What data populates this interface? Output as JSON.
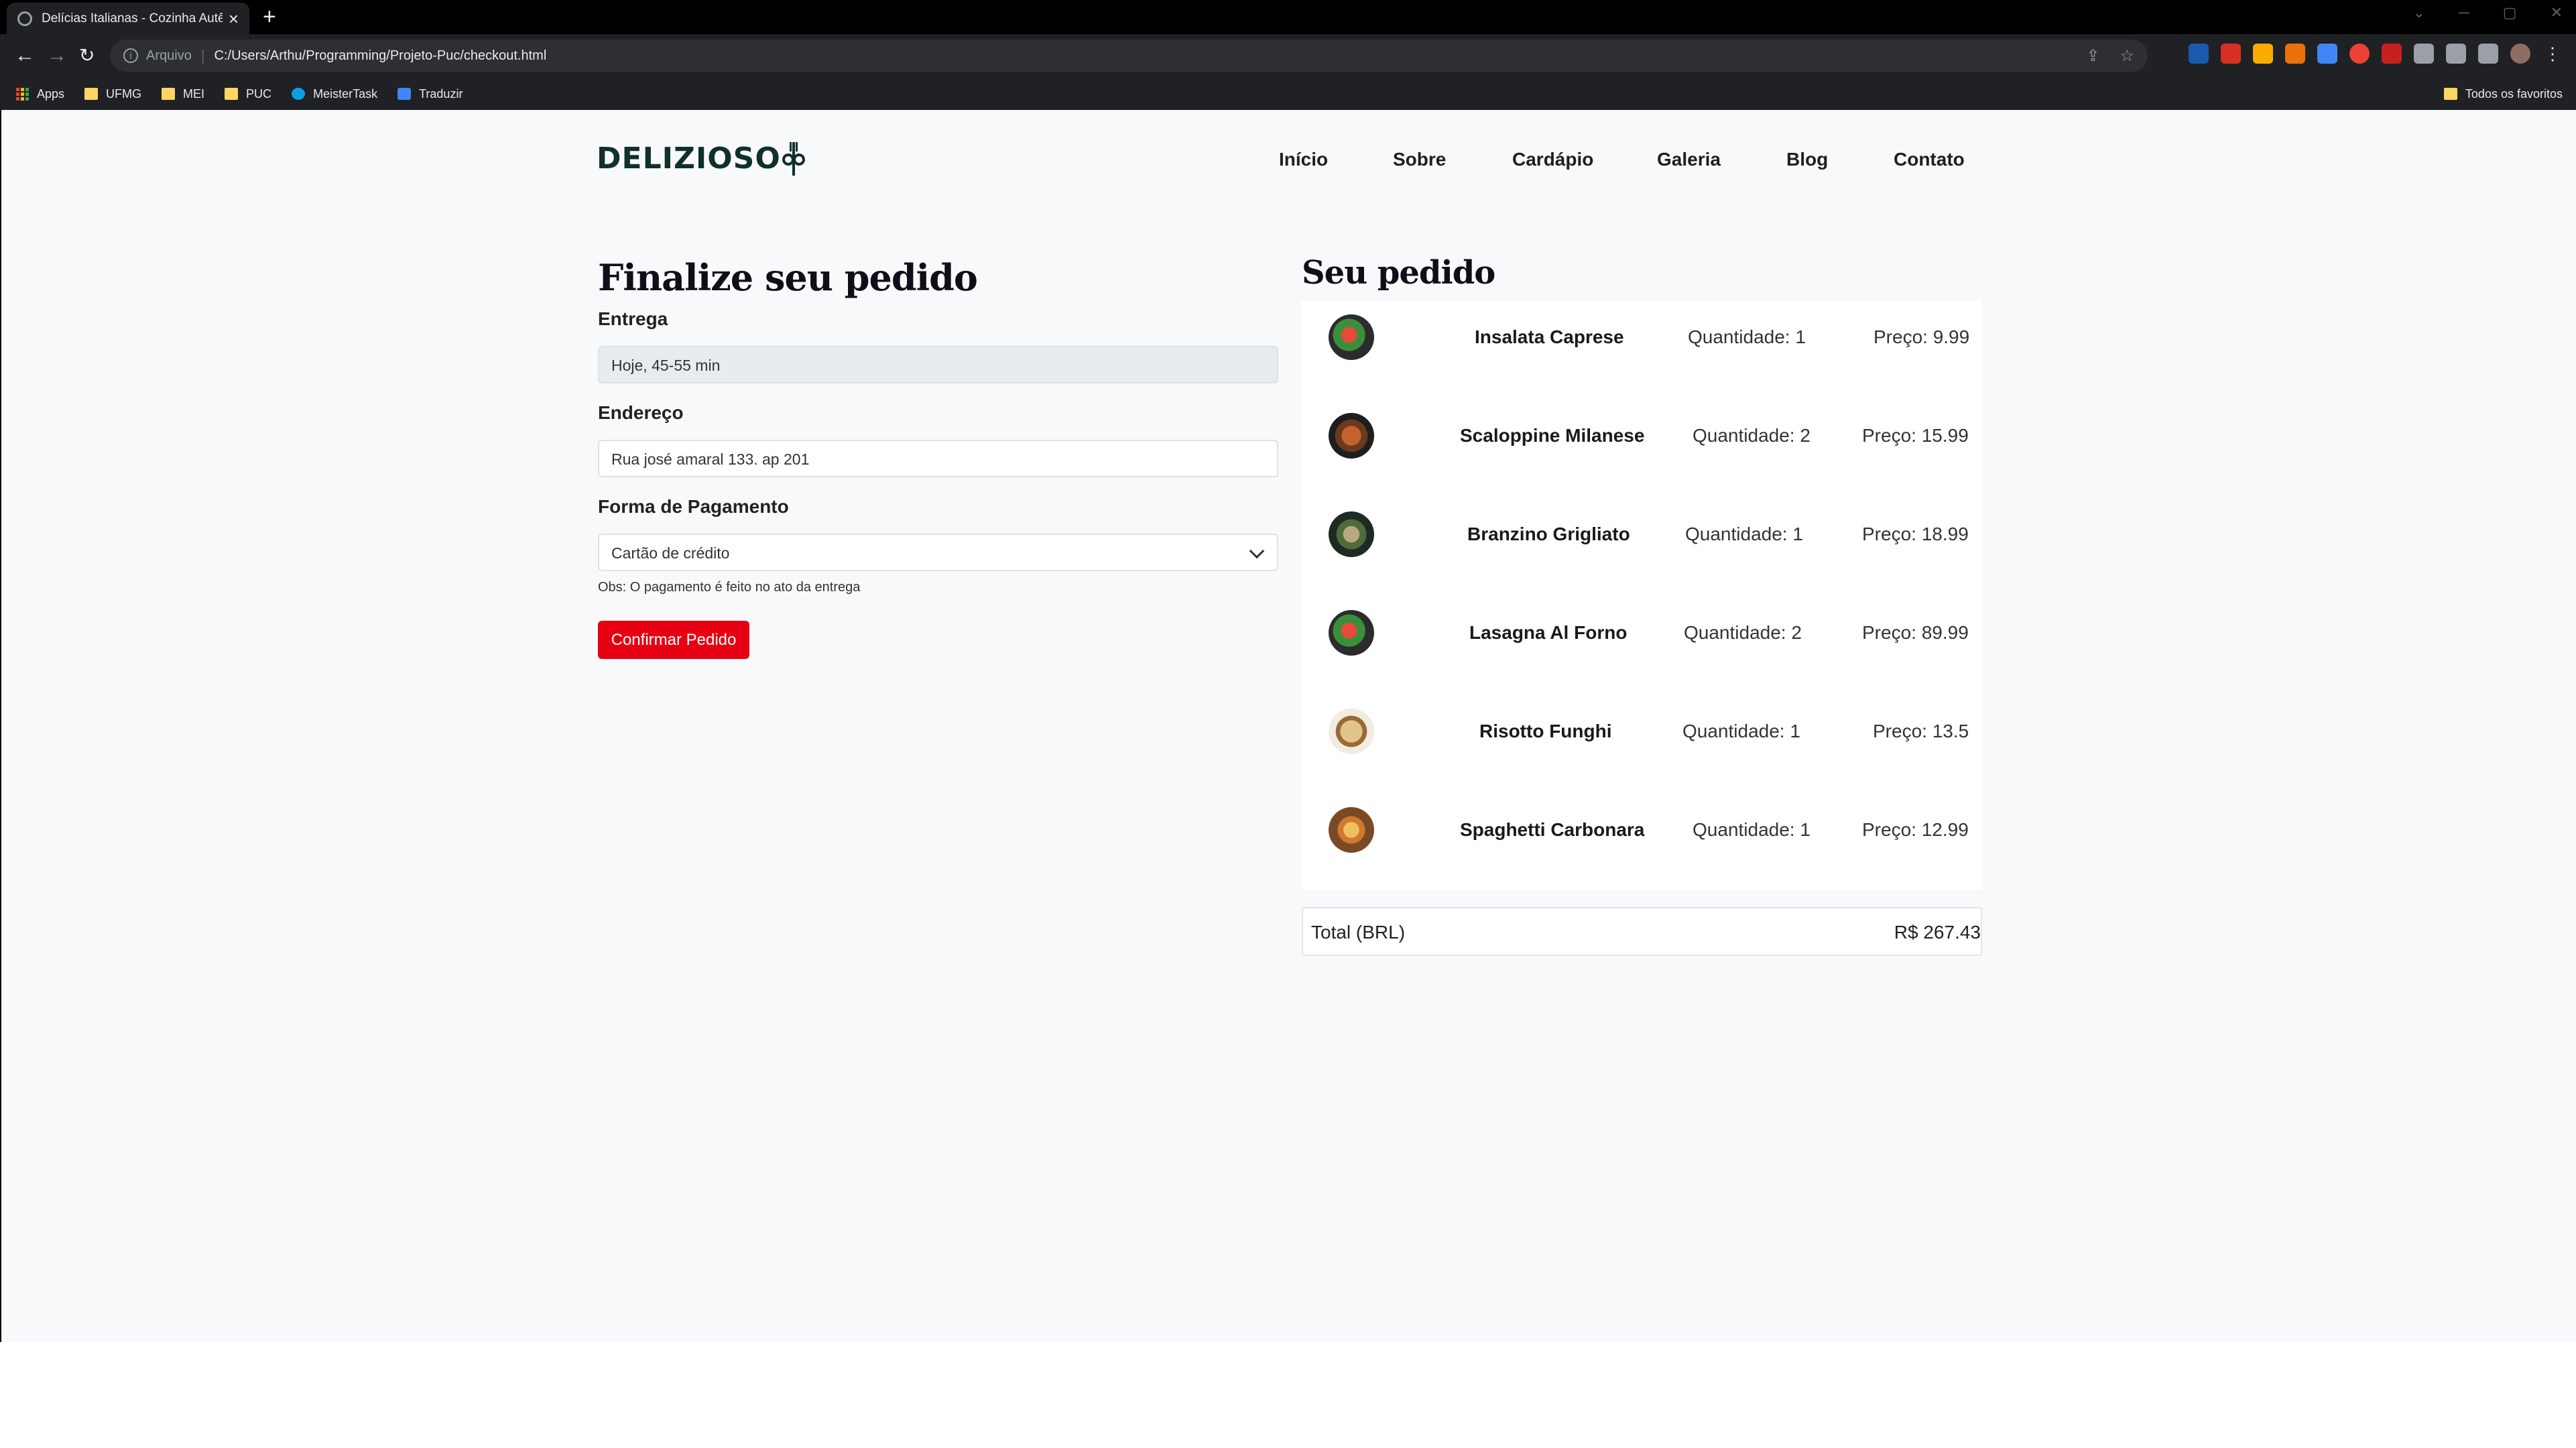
{
  "browser": {
    "tab_title": "Delícias Italianas - Cozinha Autê",
    "url_scheme": "Arquivo",
    "url": "C:/Users/Arthu/Programming/Projeto-Puc/checkout.html",
    "bookmarks": [
      "Apps",
      "UFMG",
      "MEI",
      "PUC",
      "MeisterTask",
      "Traduzir"
    ],
    "all_bookmarks": "Todos os favoritos"
  },
  "site": {
    "logo": "DELIZIOSO",
    "nav": [
      "Início",
      "Sobre",
      "Cardápio",
      "Galeria",
      "Blog",
      "Contato"
    ]
  },
  "checkout": {
    "title": "Finalize seu pedido",
    "delivery_label": "Entrega",
    "delivery_value": "Hoje, 45-55 min",
    "address_label": "Endereço",
    "address_value": "Rua josé amaral 133. ap 201",
    "payment_label": "Forma de Pagamento",
    "payment_value": "Cartão de crédito",
    "note": "Obs: O pagamento é feito no ato da entrega",
    "confirm_label": "Confirmar Pedido"
  },
  "order": {
    "title": "Seu pedido",
    "items": [
      {
        "name": "Insalata Caprese",
        "qty": "Quantidade: 1",
        "price": "Preço: 9.99"
      },
      {
        "name": "Scaloppine Milanese",
        "qty": "Quantidade: 2",
        "price": "Preço: 15.99"
      },
      {
        "name": "Branzino Grigliato",
        "qty": "Quantidade: 1",
        "price": "Preço: 18.99"
      },
      {
        "name": "Lasagna Al Forno",
        "qty": "Quantidade: 2",
        "price": "Preço: 89.99"
      },
      {
        "name": "Risotto Funghi",
        "qty": "Quantidade: 1",
        "price": "Preço: 13.5"
      },
      {
        "name": "Spaghetti Carbonara",
        "qty": "Quantidade: 1",
        "price": "Preço: 12.99"
      }
    ],
    "total_label": "Total (BRL)",
    "total_value": "R$ 267.43"
  },
  "colors": {
    "accent": "#e60012",
    "logo": "#10302a",
    "page_bg": "#f8f9fa"
  }
}
